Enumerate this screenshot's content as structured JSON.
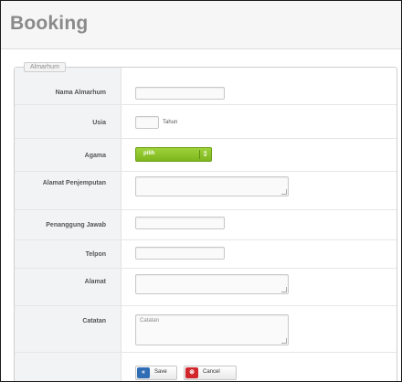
{
  "page": {
    "title": "Booking"
  },
  "form": {
    "legend": "Almarhum",
    "fields": {
      "nama_almarhum": {
        "label": "Nama Almarhum",
        "value": ""
      },
      "usia": {
        "label": "Usia",
        "value": "",
        "suffix": "Tahun"
      },
      "agama": {
        "label": "Agama",
        "selected": "pilih"
      },
      "alamat_penjemputan": {
        "label": "Alamat Penjemputan",
        "value": ""
      },
      "penanggung_jawab": {
        "label": "Penanggung Jawab",
        "value": ""
      },
      "telpon": {
        "label": "Telpon",
        "value": ""
      },
      "alamat": {
        "label": "Alamat",
        "value": ""
      },
      "catatan": {
        "label": "Catatan",
        "value": "",
        "placeholder": "Catatan"
      }
    },
    "buttons": {
      "save": {
        "label": "Save",
        "icon": "save-icon",
        "color": "#2f6db5"
      },
      "cancel": {
        "label": "Cancel",
        "icon": "cancel-icon",
        "color": "#d1262b"
      }
    }
  },
  "colors": {
    "accent_select": "#8cc63f",
    "label_column": "#f1f3f5"
  }
}
